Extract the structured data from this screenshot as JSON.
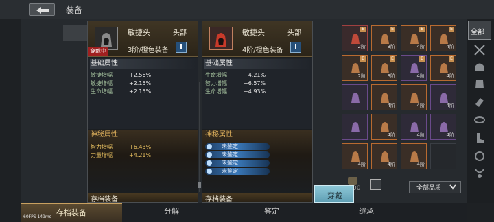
{
  "header": {
    "title": "装备"
  },
  "cards": [
    {
      "name": "敏捷头",
      "slot": "头部",
      "tier": "3阶/橙色装备",
      "equipped": "穿戴中",
      "basic_title": "基础属性",
      "basic": [
        {
          "k": "敏捷增幅",
          "v": "+2.56%"
        },
        {
          "k": "敏捷增幅",
          "v": "+2.15%"
        },
        {
          "k": "生命增幅",
          "v": "+2.15%"
        }
      ],
      "myst_title": "神秘属性",
      "myst": [
        {
          "k": "智力增幅",
          "v": "+6.43%"
        },
        {
          "k": "力量增幅",
          "v": "+4.21%"
        }
      ],
      "footer": "存档装备"
    },
    {
      "name": "敏捷头",
      "slot": "头部",
      "tier": "4阶/橙色装备",
      "basic_title": "基础属性",
      "basic": [
        {
          "k": "生命增幅",
          "v": "+4.21%"
        },
        {
          "k": "智力增幅",
          "v": "+6.57%"
        },
        {
          "k": "生命增幅",
          "v": "+4.93%"
        }
      ],
      "myst_title": "神秘属性",
      "unidentified": [
        "未鉴定",
        "未鉴定",
        "未鉴定",
        "未鉴定"
      ],
      "footer": "存档装备"
    }
  ],
  "inventory": [
    {
      "tier": "2阶",
      "e": "E",
      "q": "red"
    },
    {
      "tier": "3阶",
      "e": "E",
      "q": "orange"
    },
    {
      "tier": "4阶",
      "e": "E",
      "q": "orange"
    },
    {
      "tier": "4阶",
      "e": "E",
      "q": "orange"
    },
    {
      "tier": "2阶",
      "e": "E",
      "q": "orange"
    },
    {
      "tier": "3阶",
      "e": "E",
      "q": "orange"
    },
    {
      "tier": "4阶",
      "e": "E",
      "q": "purple"
    },
    {
      "tier": "4阶",
      "e": "E",
      "q": "orange"
    },
    {
      "tier": "",
      "e": "",
      "q": "purple"
    },
    {
      "tier": "4阶",
      "e": "",
      "q": "orange"
    },
    {
      "tier": "4阶",
      "e": "",
      "q": "orange"
    },
    {
      "tier": "4阶",
      "e": "",
      "q": "purple"
    },
    {
      "tier": "",
      "e": "",
      "q": "purple"
    },
    {
      "tier": "4阶",
      "e": "",
      "q": "orange"
    },
    {
      "tier": "4阶",
      "e": "",
      "q": "purple"
    },
    {
      "tier": "4阶",
      "e": "",
      "q": "purple"
    },
    {
      "tier": "4阶",
      "e": "",
      "q": "orange"
    },
    {
      "tier": "4阶",
      "e": "",
      "q": "orange"
    },
    {
      "tier": "4阶",
      "e": "",
      "q": "orange"
    },
    {
      "tier": "",
      "e": "",
      "q": "empty"
    }
  ],
  "categories": {
    "active": "全部"
  },
  "actions": {
    "equip": "穿戴",
    "quality_filter": "全部品质",
    "pot_count": "00"
  },
  "bottom_tabs": [
    "存档装备",
    "分解",
    "鉴定",
    "继承"
  ],
  "debug": {
    "fps": "60FPS   149ms"
  }
}
